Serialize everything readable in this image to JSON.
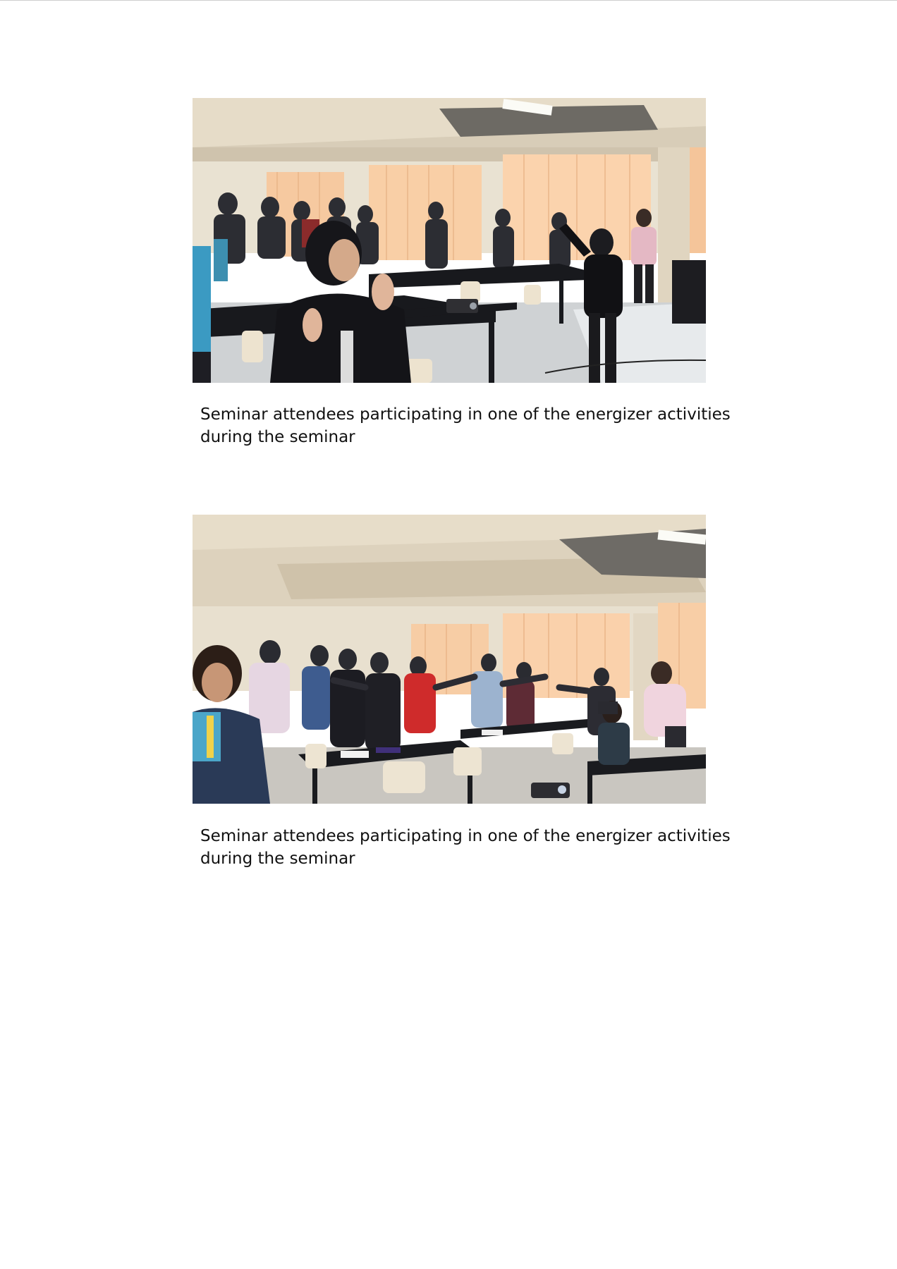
{
  "figures": [
    {
      "photo_description": "Seminar attendees standing and clapping",
      "caption_line1": "Seminar attendees participating in one of the energizer activities",
      "caption_line2": "during the seminar"
    },
    {
      "photo_description": "Seminar attendees standing with arms extended",
      "caption_line1": "Seminar attendees participating in one of the energizer activities",
      "caption_line2": "during the seminar"
    }
  ]
}
